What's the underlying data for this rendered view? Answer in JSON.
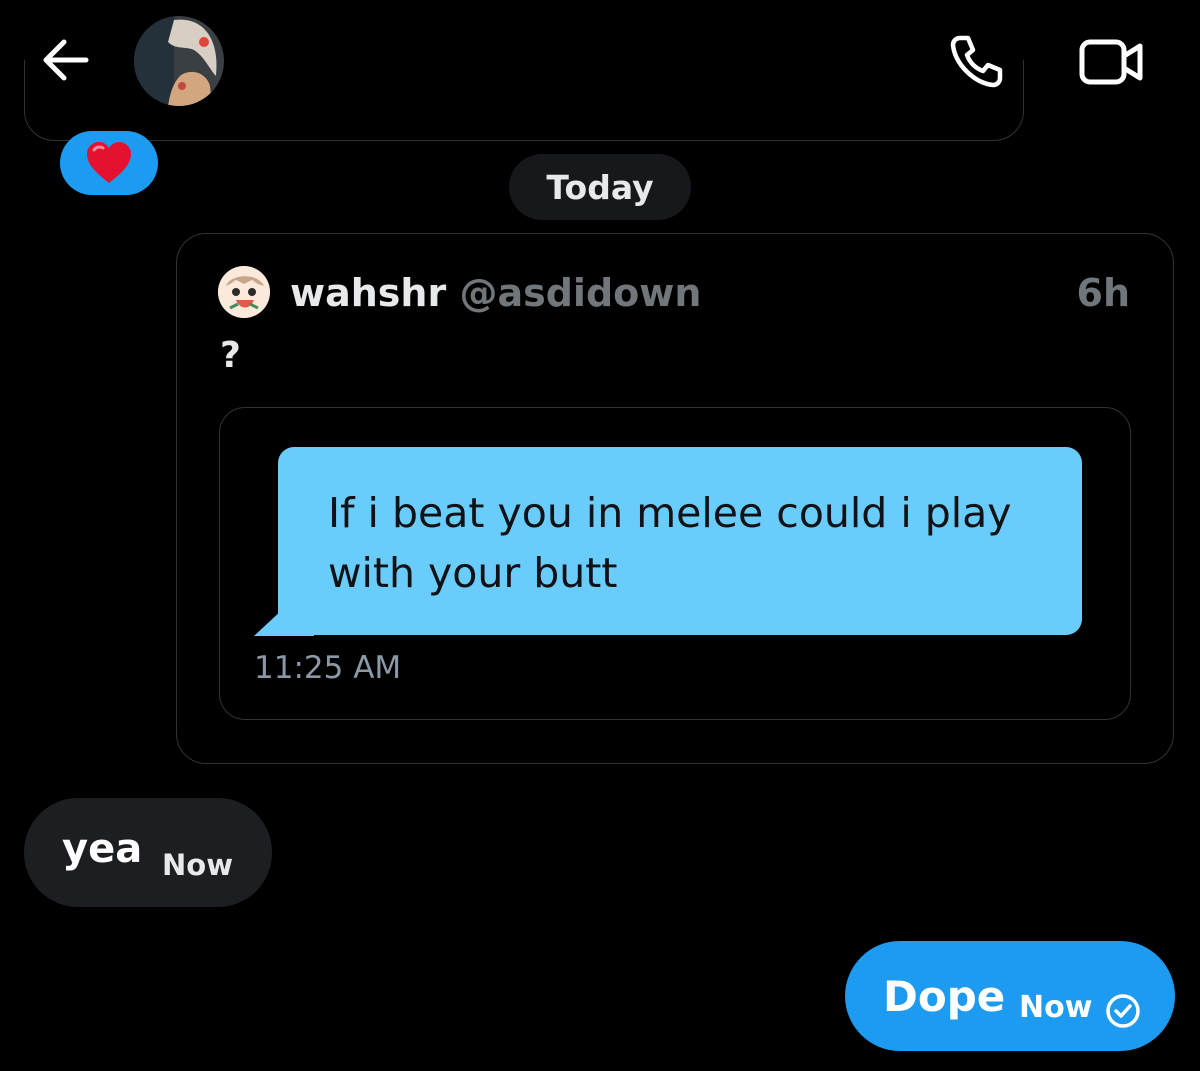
{
  "header": {
    "back_icon": "arrow-left-icon",
    "call_icon": "phone-icon",
    "video_icon": "video-camera-icon"
  },
  "reaction": {
    "emoji": "❤️"
  },
  "date_divider": "Today",
  "quoted_post": {
    "display_name": "wahshr",
    "handle": "@asdidown",
    "age": "6h",
    "text": "?",
    "image": {
      "bubble_text": "If i beat you in melee could i play with your butt",
      "timestamp": "11:25 AM",
      "bubble_color": "#69ccfb"
    }
  },
  "messages": [
    {
      "direction": "received",
      "text": "yea",
      "time": "Now"
    },
    {
      "direction": "sent",
      "text": "Dope",
      "time": "Now",
      "status_icon": "check-circle-icon"
    }
  ],
  "colors": {
    "accent": "#1d9bf0",
    "background": "#000000",
    "received_bubble": "#1c1e21",
    "border": "#2f3336",
    "muted_text": "#71767b"
  }
}
